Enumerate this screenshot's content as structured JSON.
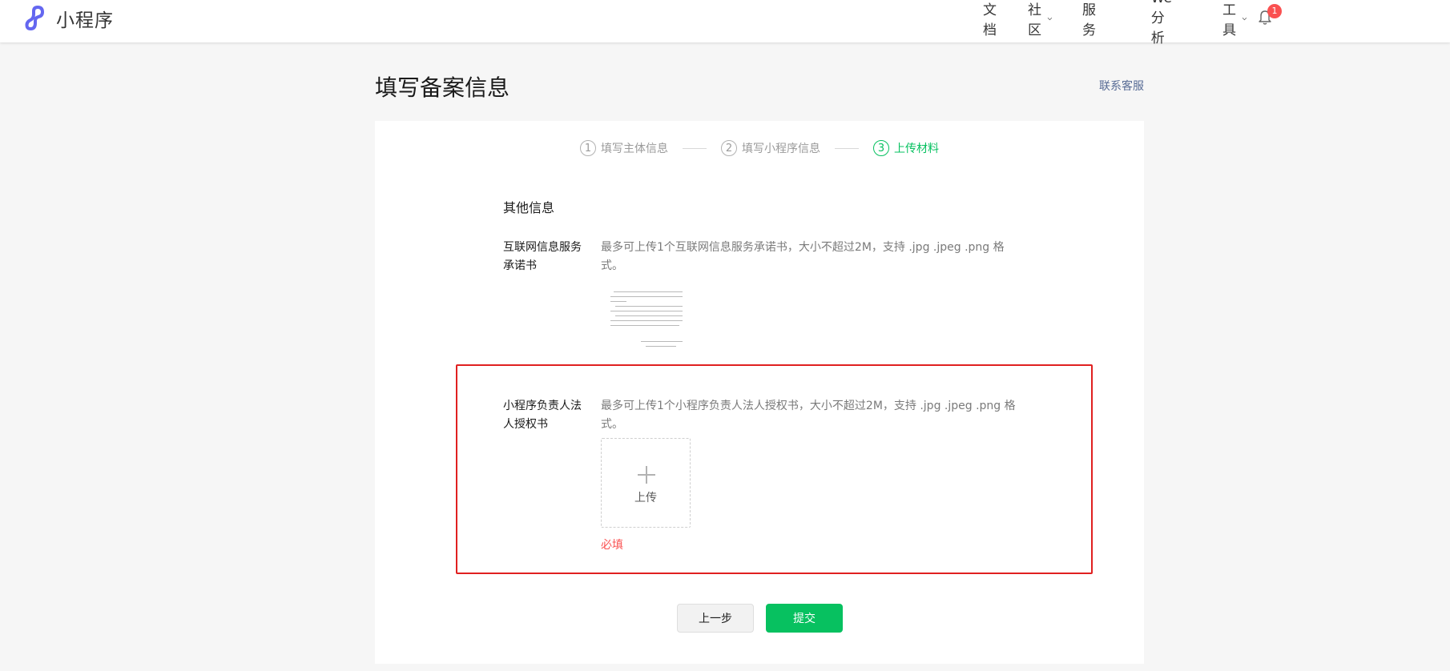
{
  "brand": {
    "name": "小程序"
  },
  "nav": {
    "items": [
      {
        "label": "文档",
        "has_dropdown": false
      },
      {
        "label": "社区",
        "has_dropdown": true
      },
      {
        "label": "服务",
        "has_dropdown": false
      },
      {
        "label": "We分析",
        "has_dropdown": false
      },
      {
        "label": "工具",
        "has_dropdown": true
      }
    ],
    "notification_count": "1"
  },
  "page": {
    "title": "填写备案信息",
    "contact_link": "联系客服"
  },
  "steps": [
    {
      "num": "1",
      "label": "填写主体信息",
      "state": "done"
    },
    {
      "num": "2",
      "label": "填写小程序信息",
      "state": "done"
    },
    {
      "num": "3",
      "label": "上传材料",
      "state": "active"
    }
  ],
  "form": {
    "section_title": "其他信息",
    "fields": [
      {
        "label": "互联网信息服务承诺书",
        "tip": "最多可上传1个互联网信息服务承诺书，大小不超过2M，支持 .jpg .jpeg .png 格式。",
        "uploaded": true
      },
      {
        "label": "小程序负责人法人授权书",
        "tip": "最多可上传1个小程序负责人法人授权书，大小不超过2M，支持 .jpg .jpeg .png 格式。",
        "upload_label": "上传",
        "error": "必填"
      }
    ]
  },
  "buttons": {
    "prev": "上一步",
    "submit": "提交"
  },
  "colors": {
    "accent": "#07c160",
    "error": "#fa5151",
    "highlight_border": "#e02020",
    "link": "#576b95"
  }
}
